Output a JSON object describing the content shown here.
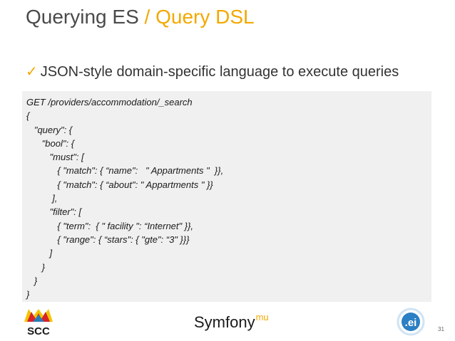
{
  "slide": {
    "title_main": "Querying ES",
    "title_sep": " / ",
    "title_sub": "Query DSL",
    "bullet_icon": "check-icon",
    "bullet_check": "✓",
    "bullet_text": "JSON-style domain-specific language to execute queries",
    "code_lines": [
      "GET /providers/accommodation/_search",
      "{",
      "   \"query\": {",
      "      \"bool\": {",
      "         \"must\": [",
      "            { \"match\": { “name\":   \" Appartments \"  }},",
      "            { \"match\": { “about\": \" Appartments \" }}",
      "          ],",
      "         \"filter\": [",
      "            { \"term\":  { \" facility \": “Internet\" }},",
      "            { \"range\": { “stars\": { \"gte\": “3\" }}}",
      "         ]",
      "      }",
      "   }",
      "}"
    ],
    "footer": {
      "logo_left_text": "SCC",
      "brand": "Symfony",
      "brand_sup": "mu",
      "logo_right_text": ".ei",
      "page_number": "31"
    },
    "colors": {
      "accent": "#f2a900",
      "title": "#4a4a4a",
      "code_bg": "#f0f0f0"
    }
  }
}
